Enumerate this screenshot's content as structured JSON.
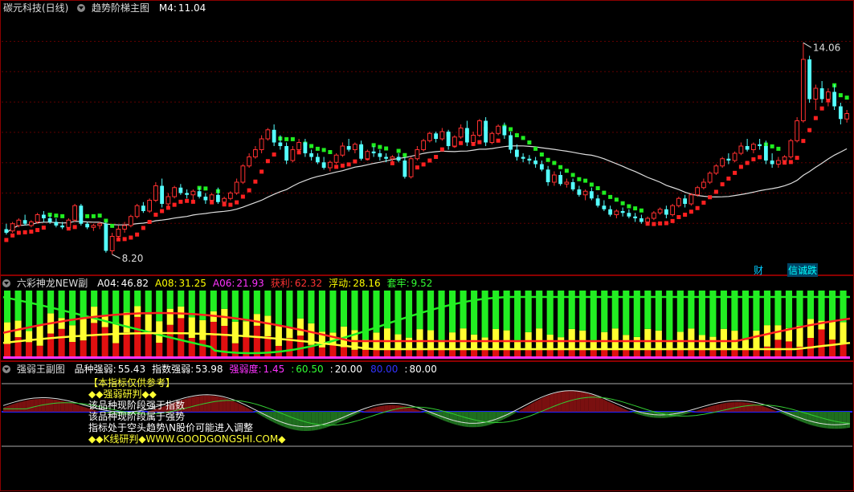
{
  "main_panel": {
    "stock_name": "碳元科技(日线)",
    "indicator_name": "趋势阶梯主图",
    "ma_label": "M4:",
    "ma_value": "11.04",
    "high_label": "14.06",
    "low_label": "8.20",
    "tag_fin": "财",
    "tag_info": "信诚跌"
  },
  "panel2": {
    "name": "六彩神龙NEW副",
    "items": [
      {
        "label": "A04:",
        "value": "46.82",
        "color": "#ffffff"
      },
      {
        "label": "A08:",
        "value": "31.25",
        "color": "#ffff00"
      },
      {
        "label": "A06:",
        "value": "21.93",
        "color": "#ff33ff"
      },
      {
        "label": "获利:",
        "value": "62.32",
        "color": "#ff3333"
      },
      {
        "label": "浮动:",
        "value": "28.16",
        "color": "#ffff00"
      },
      {
        "label": "套牢:",
        "value": "9.52",
        "color": "#33ff33"
      }
    ]
  },
  "panel3": {
    "name": "强弱王副图",
    "items": [
      {
        "label": "品种强弱:",
        "value": "55.43",
        "color": "#ffffff"
      },
      {
        "label": "指数强弱:",
        "value": "53.98",
        "color": "#ffffff"
      },
      {
        "label": "强弱度:",
        "value": "1.45",
        "color": "#ff33ff"
      },
      {
        "label": ":",
        "value": "60.50",
        "color": "#33ff33"
      },
      {
        "label": ":",
        "value": "20.00",
        "color": "#ffffff"
      },
      {
        "label": "",
        "value": "80.00",
        "color": "#3333ff"
      },
      {
        "label": ":",
        "value": "80.00",
        "color": "#ffffff"
      }
    ],
    "notes": [
      "【本指标仅供参考】",
      "◆◆强弱研判◆◆",
      "该品种现阶段强于指数",
      "该品种现阶段属于强势",
      "指标处于空头趋势\\N股价可能进入调整",
      "◆◆K线研判◆WWW.GOODGONGSHI.COM◆"
    ]
  },
  "chart_data": [
    {
      "type": "candlestick",
      "title": "趋势阶梯主图",
      "ylim": [
        7.8,
        14.8
      ],
      "annotations": [
        {
          "text": "14.06",
          "kind": "high"
        },
        {
          "text": "8.20",
          "kind": "low"
        }
      ],
      "ohlc": [
        [
          8.9,
          9.05,
          8.75,
          8.8
        ],
        [
          8.85,
          9.1,
          8.8,
          9.05
        ],
        [
          9.0,
          9.2,
          8.95,
          9.15
        ],
        [
          9.15,
          9.3,
          9.0,
          9.05
        ],
        [
          9.0,
          9.15,
          8.95,
          9.1
        ],
        [
          9.1,
          9.35,
          9.05,
          9.3
        ],
        [
          9.3,
          9.4,
          9.1,
          9.2
        ],
        [
          9.2,
          9.3,
          9.05,
          9.1
        ],
        [
          9.1,
          9.2,
          8.95,
          9.0
        ],
        [
          9.0,
          9.1,
          8.9,
          8.95
        ],
        [
          8.95,
          9.2,
          8.9,
          9.15
        ],
        [
          9.15,
          9.6,
          9.1,
          9.55
        ],
        [
          9.55,
          9.6,
          9.0,
          9.05
        ],
        [
          9.05,
          9.1,
          8.9,
          8.95
        ],
        [
          8.95,
          9.05,
          8.85,
          9.0
        ],
        [
          9.0,
          9.1,
          8.9,
          9.05
        ],
        [
          9.05,
          9.1,
          8.25,
          8.3
        ],
        [
          8.3,
          8.8,
          8.2,
          8.7
        ],
        [
          8.7,
          9.0,
          8.6,
          8.9
        ],
        [
          8.9,
          9.1,
          8.8,
          9.0
        ],
        [
          9.0,
          9.3,
          8.95,
          9.25
        ],
        [
          9.25,
          9.6,
          9.2,
          9.55
        ],
        [
          9.55,
          9.65,
          9.35,
          9.4
        ],
        [
          9.4,
          9.75,
          9.35,
          9.7
        ],
        [
          9.7,
          10.2,
          9.65,
          10.1
        ],
        [
          10.1,
          10.3,
          9.5,
          9.6
        ],
        [
          9.6,
          9.9,
          9.5,
          9.8
        ],
        [
          9.8,
          10.1,
          9.75,
          10.05
        ],
        [
          10.05,
          10.15,
          9.85,
          9.9
        ],
        [
          9.9,
          10.0,
          9.75,
          9.85
        ],
        [
          9.85,
          10.0,
          9.7,
          9.95
        ],
        [
          9.95,
          10.05,
          9.75,
          9.8
        ],
        [
          9.8,
          9.9,
          9.6,
          9.7
        ],
        [
          9.7,
          9.9,
          9.65,
          9.85
        ],
        [
          9.85,
          10.05,
          9.6,
          9.65
        ],
        [
          9.65,
          9.8,
          9.6,
          9.75
        ],
        [
          9.75,
          9.95,
          9.7,
          9.9
        ],
        [
          9.9,
          10.3,
          9.85,
          10.2
        ],
        [
          10.2,
          10.7,
          10.15,
          10.65
        ],
        [
          10.65,
          11.0,
          10.6,
          10.9
        ],
        [
          10.9,
          11.2,
          10.85,
          11.1
        ],
        [
          11.1,
          11.5,
          11.0,
          11.4
        ],
        [
          11.4,
          11.7,
          11.35,
          11.65
        ],
        [
          11.65,
          11.8,
          11.2,
          11.3
        ],
        [
          11.3,
          11.5,
          11.1,
          11.2
        ],
        [
          11.2,
          11.3,
          10.7,
          10.8
        ],
        [
          10.8,
          11.2,
          10.75,
          11.1
        ],
        [
          11.1,
          11.4,
          11.0,
          11.3
        ],
        [
          11.3,
          11.4,
          10.9,
          11.0
        ],
        [
          11.0,
          11.1,
          10.8,
          10.9
        ],
        [
          10.9,
          11.0,
          10.7,
          10.75
        ],
        [
          10.75,
          10.9,
          10.55,
          10.6
        ],
        [
          10.6,
          10.8,
          10.5,
          10.75
        ],
        [
          10.75,
          11.0,
          10.7,
          10.95
        ],
        [
          10.95,
          11.3,
          10.9,
          11.2
        ],
        [
          11.2,
          11.4,
          11.05,
          11.1
        ],
        [
          11.1,
          11.3,
          11.0,
          11.25
        ],
        [
          11.25,
          11.35,
          10.8,
          10.85
        ],
        [
          10.85,
          11.1,
          10.8,
          11.05
        ],
        [
          11.05,
          11.2,
          10.9,
          11.0
        ],
        [
          11.0,
          11.1,
          10.8,
          10.9
        ],
        [
          10.9,
          11.0,
          10.75,
          10.85
        ],
        [
          10.85,
          10.95,
          10.75,
          10.9
        ],
        [
          10.9,
          11.0,
          10.75,
          10.8
        ],
        [
          10.8,
          10.9,
          10.3,
          10.35
        ],
        [
          10.35,
          10.9,
          10.3,
          10.85
        ],
        [
          10.85,
          11.2,
          10.8,
          11.1
        ],
        [
          11.1,
          11.4,
          11.05,
          11.35
        ],
        [
          11.35,
          11.6,
          11.3,
          11.55
        ],
        [
          11.55,
          11.6,
          11.3,
          11.4
        ],
        [
          11.4,
          11.7,
          11.35,
          11.6
        ],
        [
          11.6,
          11.65,
          11.1,
          11.2
        ],
        [
          11.2,
          11.5,
          11.15,
          11.45
        ],
        [
          11.45,
          11.8,
          11.4,
          11.7
        ],
        [
          11.7,
          11.9,
          11.2,
          11.3
        ],
        [
          11.3,
          11.6,
          11.2,
          11.5
        ],
        [
          11.5,
          11.95,
          11.45,
          11.9
        ],
        [
          11.9,
          12.0,
          11.2,
          11.3
        ],
        [
          11.3,
          11.6,
          11.25,
          11.55
        ],
        [
          11.55,
          11.8,
          11.5,
          11.75
        ],
        [
          11.75,
          11.85,
          11.4,
          11.5
        ],
        [
          11.5,
          11.6,
          11.0,
          11.1
        ],
        [
          11.1,
          11.25,
          10.8,
          10.9
        ],
        [
          10.9,
          11.0,
          10.75,
          10.85
        ],
        [
          10.85,
          10.95,
          10.7,
          10.8
        ],
        [
          10.8,
          10.9,
          10.6,
          10.7
        ],
        [
          10.7,
          10.8,
          10.5,
          10.55
        ],
        [
          10.55,
          10.65,
          10.1,
          10.2
        ],
        [
          10.2,
          10.5,
          10.1,
          10.4
        ],
        [
          10.4,
          10.5,
          10.1,
          10.15
        ],
        [
          10.15,
          10.3,
          10.05,
          10.2
        ],
        [
          10.2,
          10.3,
          9.95,
          10.0
        ],
        [
          10.0,
          10.1,
          9.8,
          9.85
        ],
        [
          9.85,
          10.0,
          9.7,
          9.95
        ],
        [
          9.95,
          10.05,
          9.7,
          9.75
        ],
        [
          9.75,
          9.85,
          9.5,
          9.55
        ],
        [
          9.55,
          9.7,
          9.4,
          9.45
        ],
        [
          9.45,
          9.55,
          9.25,
          9.3
        ],
        [
          9.3,
          9.45,
          9.2,
          9.4
        ],
        [
          9.4,
          9.5,
          9.25,
          9.35
        ],
        [
          9.35,
          9.45,
          9.2,
          9.25
        ],
        [
          9.25,
          9.35,
          9.1,
          9.2
        ],
        [
          9.2,
          9.3,
          9.05,
          9.1
        ],
        [
          9.1,
          9.25,
          9.0,
          9.2
        ],
        [
          9.2,
          9.4,
          9.15,
          9.35
        ],
        [
          9.35,
          9.5,
          9.3,
          9.45
        ],
        [
          9.45,
          9.55,
          9.2,
          9.3
        ],
        [
          9.3,
          9.6,
          9.25,
          9.55
        ],
        [
          9.55,
          9.8,
          9.5,
          9.75
        ],
        [
          9.75,
          9.85,
          9.5,
          9.6
        ],
        [
          9.6,
          9.9,
          9.55,
          9.85
        ],
        [
          9.85,
          10.1,
          9.8,
          10.05
        ],
        [
          10.05,
          10.3,
          10.0,
          10.2
        ],
        [
          10.2,
          10.5,
          10.15,
          10.45
        ],
        [
          10.45,
          10.7,
          10.4,
          10.65
        ],
        [
          10.65,
          10.9,
          10.6,
          10.85
        ],
        [
          10.85,
          11.0,
          10.7,
          10.8
        ],
        [
          10.8,
          11.05,
          10.75,
          11.0
        ],
        [
          11.0,
          11.3,
          10.95,
          11.2
        ],
        [
          11.2,
          11.4,
          11.05,
          11.1
        ],
        [
          11.1,
          11.3,
          11.0,
          11.25
        ],
        [
          11.25,
          11.4,
          11.1,
          11.2
        ],
        [
          11.2,
          11.35,
          10.7,
          10.8
        ],
        [
          10.8,
          11.0,
          10.6,
          10.7
        ],
        [
          10.7,
          10.9,
          10.6,
          10.8
        ],
        [
          10.8,
          10.95,
          10.7,
          10.9
        ],
        [
          10.9,
          11.4,
          10.85,
          11.35
        ],
        [
          11.35,
          12.0,
          11.3,
          11.9
        ],
        [
          11.9,
          14.06,
          11.85,
          13.6
        ],
        [
          13.6,
          13.7,
          12.4,
          12.5
        ],
        [
          12.5,
          12.9,
          12.2,
          12.8
        ],
        [
          12.8,
          13.0,
          12.4,
          12.5
        ],
        [
          12.5,
          12.8,
          12.3,
          12.7
        ],
        [
          12.7,
          12.9,
          12.2,
          12.3
        ],
        [
          12.3,
          12.4,
          11.8,
          11.95
        ],
        [
          11.95,
          12.2,
          11.85,
          12.1
        ]
      ],
      "series": [
        {
          "name": "M4",
          "values": [
            11.04
          ]
        },
        {
          "name": "趋势阶梯",
          "values": []
        }
      ]
    },
    {
      "type": "bar",
      "title": "六彩神龙NEW副",
      "series": [
        {
          "name": "A04",
          "values": [
            46.82
          ]
        },
        {
          "name": "A08",
          "values": [
            31.25
          ]
        },
        {
          "name": "A06",
          "values": [
            21.93
          ]
        },
        {
          "name": "获利",
          "values": [
            62.32
          ]
        },
        {
          "name": "浮动",
          "values": [
            28.16
          ]
        },
        {
          "name": "套牢",
          "values": [
            9.52
          ]
        }
      ]
    },
    {
      "type": "area",
      "title": "强弱王副图",
      "series": [
        {
          "name": "品种强弱",
          "values": [
            55.43
          ]
        },
        {
          "name": "指数强弱",
          "values": [
            53.98
          ]
        },
        {
          "name": "强弱度",
          "values": [
            1.45
          ]
        }
      ],
      "hlines": [
        20.0,
        60.5,
        80.0
      ]
    }
  ]
}
